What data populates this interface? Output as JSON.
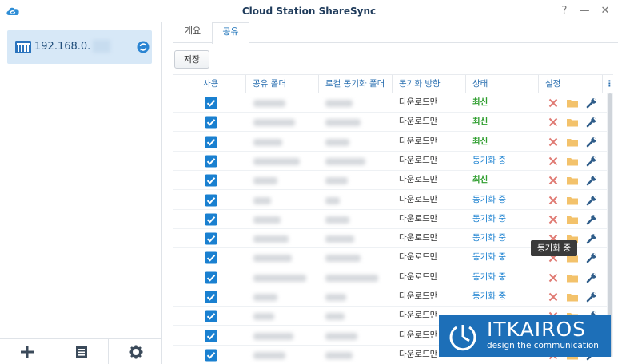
{
  "window": {
    "title": "Cloud Station ShareSync",
    "help_glyph": "?",
    "min_glyph": "—",
    "close_glyph": "✕"
  },
  "sidebar": {
    "connection": {
      "ip": "192.168.0.",
      "icon": "server-icon",
      "sync_icon": "sync-icon"
    },
    "bottom_buttons": [
      {
        "name": "add",
        "icon": "plus-icon"
      },
      {
        "name": "log",
        "icon": "list-icon"
      },
      {
        "name": "settings",
        "icon": "gear-icon"
      }
    ]
  },
  "tabs": [
    {
      "label": "개요"
    },
    {
      "label": "공유",
      "active": true
    }
  ],
  "toolbar": {
    "save_label": "저장"
  },
  "table": {
    "columns": [
      "사용",
      "공유 폴더",
      "로컬 동기화 폴더",
      "동기화 방향",
      "상태",
      "설정"
    ],
    "more_glyph": "⋮",
    "rows": [
      {
        "enabled": true,
        "direction": "다운로드만",
        "status": "최신",
        "status_kind": "latest"
      },
      {
        "enabled": true,
        "direction": "다운로드만",
        "status": "최신",
        "status_kind": "latest"
      },
      {
        "enabled": true,
        "direction": "다운로드만",
        "status": "최신",
        "status_kind": "latest"
      },
      {
        "enabled": true,
        "direction": "다운로드만",
        "status": "동기화 중",
        "status_kind": "syncing"
      },
      {
        "enabled": true,
        "direction": "다운로드만",
        "status": "최신",
        "status_kind": "latest"
      },
      {
        "enabled": true,
        "direction": "다운로드만",
        "status": "동기화 중",
        "status_kind": "syncing"
      },
      {
        "enabled": true,
        "direction": "다운로드만",
        "status": "동기화 중",
        "status_kind": "syncing"
      },
      {
        "enabled": true,
        "direction": "다운로드만",
        "status": "동기화 중",
        "status_kind": "syncing"
      },
      {
        "enabled": true,
        "direction": "다운로드만",
        "status": "동기화 중",
        "status_kind": "syncing"
      },
      {
        "enabled": true,
        "direction": "다운로드만",
        "status": "동기화 중",
        "status_kind": "syncing"
      },
      {
        "enabled": true,
        "direction": "다운로드만",
        "status": "동기화 중",
        "status_kind": "syncing"
      },
      {
        "enabled": true,
        "direction": "다운로드만",
        "status": "",
        "status_kind": "syncing"
      },
      {
        "enabled": true,
        "direction": "다운로드만",
        "status": "",
        "status_kind": "syncing"
      },
      {
        "enabled": true,
        "direction": "다운로드만",
        "status": "",
        "status_kind": "syncing"
      }
    ],
    "action_icons": [
      "remove-icon",
      "folder-icon",
      "wrench-icon"
    ]
  },
  "tooltip": {
    "text": "동기화 중"
  },
  "watermark": {
    "name": "ITKAIROS",
    "tagline": "design the communication"
  },
  "colors": {
    "accent": "#1a80d0",
    "latest": "#2e9e2e",
    "remove": "#e07a73",
    "folder": "#f3c26b",
    "wrench": "#2f5d8a",
    "selected_bg": "#d7e8f7",
    "watermark_bg": "#1d6fb8"
  }
}
